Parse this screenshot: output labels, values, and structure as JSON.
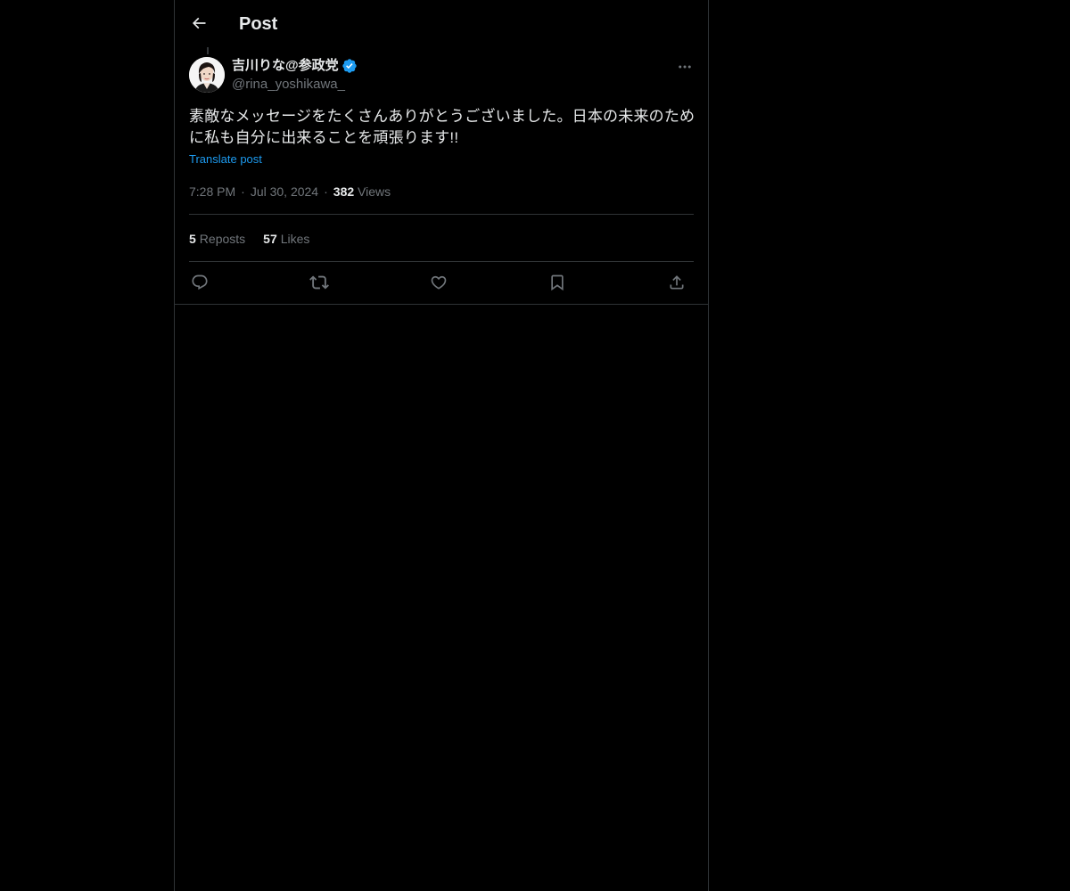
{
  "header": {
    "title": "Post",
    "back_icon": "arrow-left-icon"
  },
  "author": {
    "display_name": "吉川りな@参政党",
    "handle": "@rina_yoshikawa_",
    "verified": true,
    "verified_color": "#1d9bf0"
  },
  "post": {
    "text_line1": "素敵なメッセージをたくさんありがとうございました。日本の未来のため",
    "text_line2": "に私も自分に出来ることを頑張ります!!",
    "translate_label": "Translate post",
    "time": "7:28 PM",
    "date": "Jul 30, 2024",
    "views_count": "382",
    "views_label": "Views"
  },
  "stats": {
    "reposts_count": "5",
    "reposts_label": "Reposts",
    "likes_count": "57",
    "likes_label": "Likes"
  },
  "actions": [
    "reply-icon",
    "repost-icon",
    "like-icon",
    "bookmark-icon",
    "share-icon"
  ],
  "colors": {
    "background": "#000000",
    "text": "#e7e9ea",
    "muted": "#71767b",
    "accent": "#1d9bf0",
    "border": "#2f3336"
  }
}
